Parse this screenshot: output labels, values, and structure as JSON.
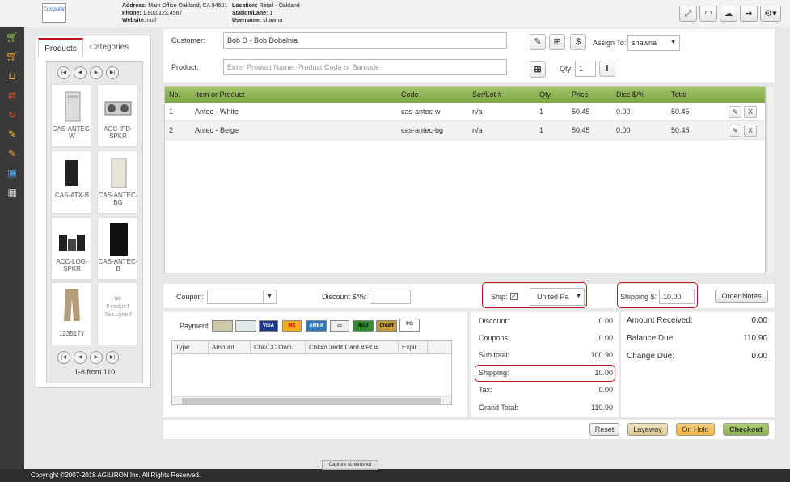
{
  "header": {
    "logo_text": "Computer",
    "address_label": "Address:",
    "address": "Main Office Oakland, CA 94601",
    "phone_label": "Phone:",
    "phone": "1.800.123.4567",
    "website_label": "Website:",
    "website": "null",
    "location_label": "Location:",
    "location": "Retail - Oakland",
    "station_label": "Station/Lane:",
    "station": "1",
    "username_label": "Username:",
    "username": "shawna",
    "icons": [
      "expand-icon",
      "wifi-icon",
      "cloud-upload-icon",
      "logout-icon",
      "gear-icon"
    ]
  },
  "nav_icons": [
    "cart-icon",
    "cart-icon",
    "cart-outline-icon",
    "transfer-icon",
    "refresh-icon",
    "edit-icon",
    "edit-icon",
    "money-icon",
    "grid-icon"
  ],
  "products_panel": {
    "tabs": [
      "Products",
      "Categories"
    ],
    "items": [
      {
        "label": "CAS-ANTEC-W"
      },
      {
        "label": "ACC-IPD-SPKR"
      },
      {
        "label": "CAS-ATX-B"
      },
      {
        "label": "CAS-ANTEC-BG"
      },
      {
        "label": "ACC-LOG-SPKR"
      },
      {
        "label": "CAS-ANTEC-B"
      },
      {
        "label": "123517Y"
      },
      {
        "label": "No Product Assigned"
      }
    ],
    "pager_text": "1-8 from 110"
  },
  "form": {
    "customer_label": "Customer:",
    "customer_value": "Bob D - Bob Dobalnia",
    "product_label": "Product:",
    "product_placeholder": "Enter Product Name, Product Code or Barcode",
    "assign_label": "Assign To:",
    "assign_value": "shawna",
    "qty_label": "Qty:",
    "qty_value": "1"
  },
  "grid": {
    "headers": [
      "No.",
      "Item or Product",
      "Code",
      "Ser/Lot #",
      "Qty",
      "Price",
      "Disc $/%",
      "Total"
    ],
    "rows": [
      {
        "no": "1",
        "item": "Antec - White",
        "code": "cas-antec-w",
        "serlot": "n/a",
        "qty": "1",
        "price": "50.45",
        "disc": "0.00",
        "total": "50.45"
      },
      {
        "no": "2",
        "item": "Antec - Beige",
        "code": "cas-antec-bg",
        "serlot": "n/a",
        "qty": "1",
        "price": "50.45",
        "disc": "0.00",
        "total": "50.45"
      }
    ]
  },
  "coupon_bar": {
    "coupon_label": "Coupon:",
    "discount_label": "Discount $/%:",
    "ship_label": "Ship:",
    "ship_country": "United Pa",
    "shipping_label": "Shipping $:",
    "shipping_value": "10.00",
    "order_notes": "Order Notes"
  },
  "payment": {
    "label": "Payment",
    "cards": [
      "cash",
      "check",
      "VISA",
      "MC",
      "AMEX",
      "card",
      "Acct",
      "Credit",
      "PO"
    ],
    "headers": [
      "Type",
      "Amount",
      "Chk/CC Own...",
      "Chk#/Credit Card #/PO#",
      "Expir..."
    ]
  },
  "totals": [
    {
      "label": "Discount:",
      "value": "0.00"
    },
    {
      "label": "Coupons:",
      "value": "0.00"
    },
    {
      "label": "Sub total:",
      "value": "100.90"
    },
    {
      "label": "Shipping:",
      "value": "10.00"
    },
    {
      "label": "Tax:",
      "value": "0.00"
    },
    {
      "label": "Grand Total:",
      "value": "110.90"
    }
  ],
  "amounts": [
    {
      "label": "Amount Received:",
      "value": "0.00"
    },
    {
      "label": "Balance Due:",
      "value": "110.90"
    },
    {
      "label": "Change Due:",
      "value": "0.00"
    }
  ],
  "buttons": {
    "reset": "Reset",
    "layaway": "Layaway",
    "on_hold": "On Hold",
    "checkout": "Checkout"
  },
  "footer": "Copyright ©2007-2018 AGILIRON Inc. All Rights Reserved.",
  "capture": "Capture screenshot",
  "colors": {
    "accent_green": "#7fa646",
    "highlight_red": "#c01818",
    "checkout": "#8ab04f",
    "on_hold": "#f5b43c"
  }
}
